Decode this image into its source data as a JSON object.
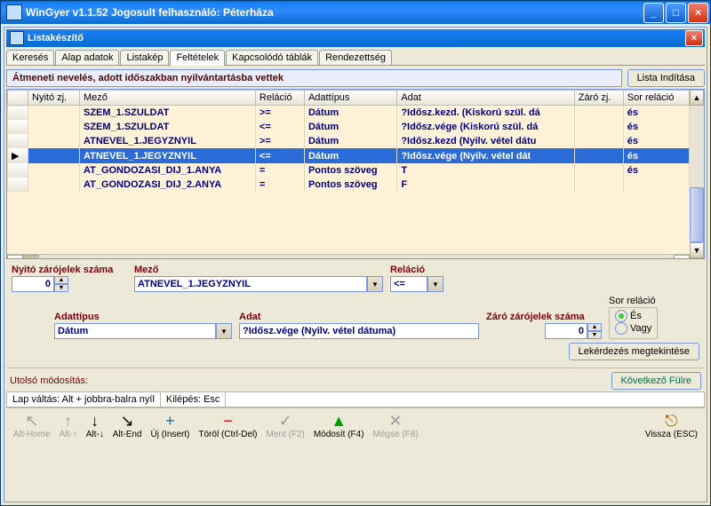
{
  "window": {
    "title": "WinGyer v1.1.52 Jogosult felhasználó: Péterháza"
  },
  "inner_window": {
    "title": "Listakészítő"
  },
  "tabs": [
    {
      "label": "Keresés"
    },
    {
      "label": "Alap adatok"
    },
    {
      "label": "Listakép"
    },
    {
      "label": "Feltételek"
    },
    {
      "label": "Kapcsolódó táblák"
    },
    {
      "label": "Rendezettség"
    }
  ],
  "active_tab": 3,
  "description": "Átmeneti nevelés, adott időszakban nyilvántartásba vettek",
  "buttons": {
    "start_list": "Lista Indítása",
    "view_query": "Lekérdezés megtekintése",
    "next_record": "Következő Fülre"
  },
  "grid": {
    "columns": [
      "Nyitó zj.",
      "Mező",
      "Reláció",
      "Adattípus",
      "Adat",
      "Záró zj.",
      "Sor reláció"
    ],
    "rows": [
      {
        "marker": "",
        "nyito": "",
        "mezo": "SZEM_1.SZULDAT",
        "rel": ">=",
        "tipus": "Dátum",
        "adat": "?Idősz.kezd. (Kiskorú szül. dá",
        "zaro": "",
        "sor": "és"
      },
      {
        "marker": "",
        "nyito": "",
        "mezo": "SZEM_1.SZULDAT",
        "rel": "<=",
        "tipus": "Dátum",
        "adat": "?Idősz.vége (Kiskorú szül. dá",
        "zaro": "",
        "sor": "és"
      },
      {
        "marker": "",
        "nyito": "",
        "mezo": "ATNEVEL_1.JEGYZNYIL",
        "rel": ">=",
        "tipus": "Dátum",
        "adat": "?Idősz.kezd (Nyilv. vétel dátu",
        "zaro": "",
        "sor": "és"
      },
      {
        "marker": "▶",
        "nyito": "",
        "mezo": "ATNEVEL_1.JEGYZNYIL",
        "rel": "<=",
        "tipus": "Dátum",
        "adat": "?Idősz.vége (Nyilv. vétel dát",
        "zaro": "",
        "sor": "és",
        "selected": true
      },
      {
        "marker": "",
        "nyito": "",
        "mezo": "AT_GONDOZASI_DIJ_1.ANYA",
        "rel": "=",
        "tipus": "Pontos szöveg",
        "adat": "T",
        "zaro": "",
        "sor": "és"
      },
      {
        "marker": "",
        "nyito": "",
        "mezo": "AT_GONDOZASI_DIJ_2.ANYA",
        "rel": "=",
        "tipus": "Pontos szöveg",
        "adat": "F",
        "zaro": "",
        "sor": ""
      }
    ]
  },
  "form": {
    "nyito_label": "Nyitó zárójelek száma",
    "nyito_value": "0",
    "mezo_label": "Mező",
    "mezo_value": "ATNEVEL_1.JEGYZNYIL",
    "relacio_label": "Reláció",
    "relacio_value": "<=",
    "adattipus_label": "Adattípus",
    "adattipus_value": "Dátum",
    "adat_label": "Adat",
    "adat_value": "?Idősz.vége (Nyilv. vétel dátuma)",
    "zaro_label": "Záró zárójelek száma",
    "zaro_value": "0",
    "sor_relacio_label": "Sor reláció",
    "radio_es": "És",
    "radio_vagy": "Vagy"
  },
  "status": {
    "last_modified_label": "Utolsó módosítás:"
  },
  "hints": {
    "lap": "Lap váltás: Alt + jobbra-balra nyíl",
    "esc": "Kilépés: Esc"
  },
  "toolbar": [
    {
      "icon": "↖",
      "label": "Alt-Home",
      "disabled": true
    },
    {
      "icon": "↑",
      "label": "Alt-↑",
      "disabled": true
    },
    {
      "icon": "↓",
      "label": "Alt-↓",
      "disabled": false,
      "color": "#000"
    },
    {
      "icon": "↘",
      "label": "Alt-End",
      "disabled": false,
      "color": "#000"
    },
    {
      "icon": "+",
      "label": "Új (Insert)",
      "disabled": false,
      "color": "#0080d0"
    },
    {
      "icon": "−",
      "label": "Töröl (Ctrl-Del)",
      "disabled": false,
      "color": "#d00000"
    },
    {
      "icon": "✓",
      "label": "Ment (F2)",
      "disabled": true
    },
    {
      "icon": "▲",
      "label": "Módosít (F4)",
      "disabled": false,
      "color": "#00a000"
    },
    {
      "icon": "✕",
      "label": "Mégse (F8)",
      "disabled": true
    },
    {
      "icon": "⎋",
      "label": "Vissza (ESC)",
      "disabled": false,
      "color": "#b06000"
    }
  ]
}
